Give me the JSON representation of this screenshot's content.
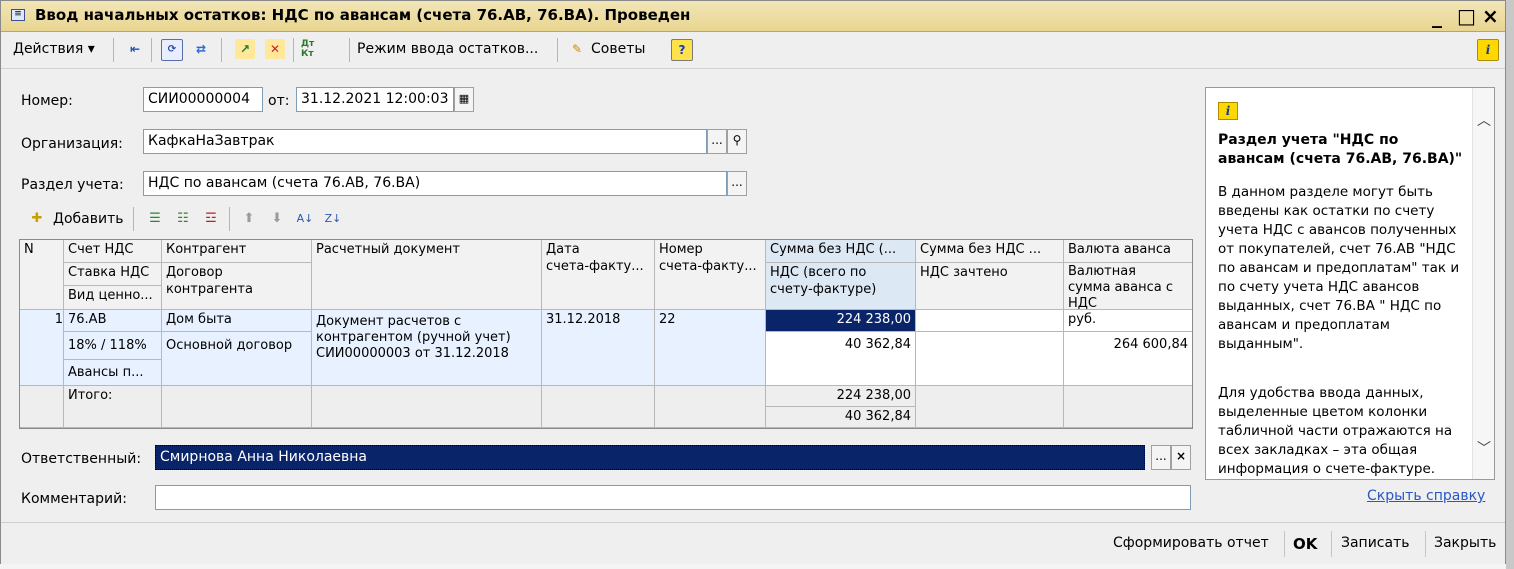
{
  "window": {
    "title": "Ввод начальных остатков: НДС по авансам (счета 76.АВ, 76.ВА). Проведен",
    "controls": [
      "_",
      "□",
      "×"
    ]
  },
  "toolbar": {
    "actions_label": "Действия ▾",
    "mode_label": "Режим ввода остатков...",
    "tips_label": "Советы",
    "help_label": "?",
    "info_label": "i",
    "dtkt_label": "Дт Кт"
  },
  "form": {
    "number_label": "Номер:",
    "number_value": "СИИ00000004",
    "from_label": "от:",
    "date_value": "31.12.2021 12:00:03",
    "org_label": "Организация:",
    "org_value": "КафкаНаЗавтрак",
    "section_label": "Раздел учета:",
    "section_value": "НДС по авансам (счета 76.АВ, 76.ВА)",
    "responsible_label": "Ответственный:",
    "responsible_value": "Смирнова Анна Николаевна",
    "comment_label": "Комментарий:",
    "comment_value": "",
    "ellipsis": "...",
    "clear": "×"
  },
  "grid_toolbar": {
    "add_label": "Добавить"
  },
  "table": {
    "headers": {
      "n": "N",
      "account": "Счет НДС",
      "rate": "Ставка НДС",
      "value_type": "Вид ценно...",
      "counterparty": "Контрагент",
      "contract": "Договор",
      "contract2": "контрагента",
      "settlement_doc": "Расчетный документ",
      "date": "Дата",
      "date2": "счета-факту...",
      "number": "Номер",
      "number2": "счета-факту...",
      "sum_no_vat": "Сумма без НДС (...",
      "vat_total": "НДС (всего по",
      "vat_total2": "счету-фактуре)",
      "sum_no_vat_offset": "Сумма без НДС ...",
      "vat_offset": "НДС зачтено",
      "adv_currency": "Валюта аванса",
      "cur_sum": "Валютная",
      "cur_sum2": "сумма аванса с",
      "cur_sum3": "НДС"
    },
    "rows": [
      {
        "n": "1",
        "account": "76.АВ",
        "rate": "18% / 118%",
        "value_type": "Авансы п...",
        "counterparty": "Дом быта",
        "contract": "Основной договор",
        "doc1": "Документ расчетов с",
        "doc2": "контрагентом (ручной учет)",
        "doc3": "СИИ00000003 от 31.12.2018",
        "date": "31.12.2018",
        "number": "22",
        "sum_no_vat": "224 238,00",
        "vat_total": "40 362,84",
        "sum_no_vat_offset": "",
        "vat_offset": "",
        "adv_currency": "руб.",
        "cur_sum": "264 600,84"
      }
    ],
    "totals": {
      "label": "Итого:",
      "sum_no_vat": "224 238,00",
      "vat_total": "40 362,84"
    }
  },
  "help": {
    "title": "Раздел учета \"НДС по авансам (счета 76.АВ, 76.ВА)\"",
    "p1": "В данном разделе могут быть введены как остатки по счету учета НДС с авансов полученных от покупателей, счет 76.АВ \"НДС по авансам и предоплатам\" так и по счету учета НДС авансов выданных, счет 76.ВА \" НДС по авансам и предоплатам выданным\".",
    "p2": "Для удобства ввода данных, выделенные цветом колонки табличной части отражаются на всех закладках – эта общая информация о счете-фактуре.",
    "hide_link": "Скрыть справку"
  },
  "footer": {
    "report_label": "Сформировать отчет",
    "ok_label": "OK",
    "save_label": "Записать",
    "close_label": "Закрыть"
  },
  "colors": {
    "title_bar": "#e8d590",
    "selection": "#0a246a",
    "highlight_column": "#dde8f5",
    "link": "#2857c5"
  }
}
